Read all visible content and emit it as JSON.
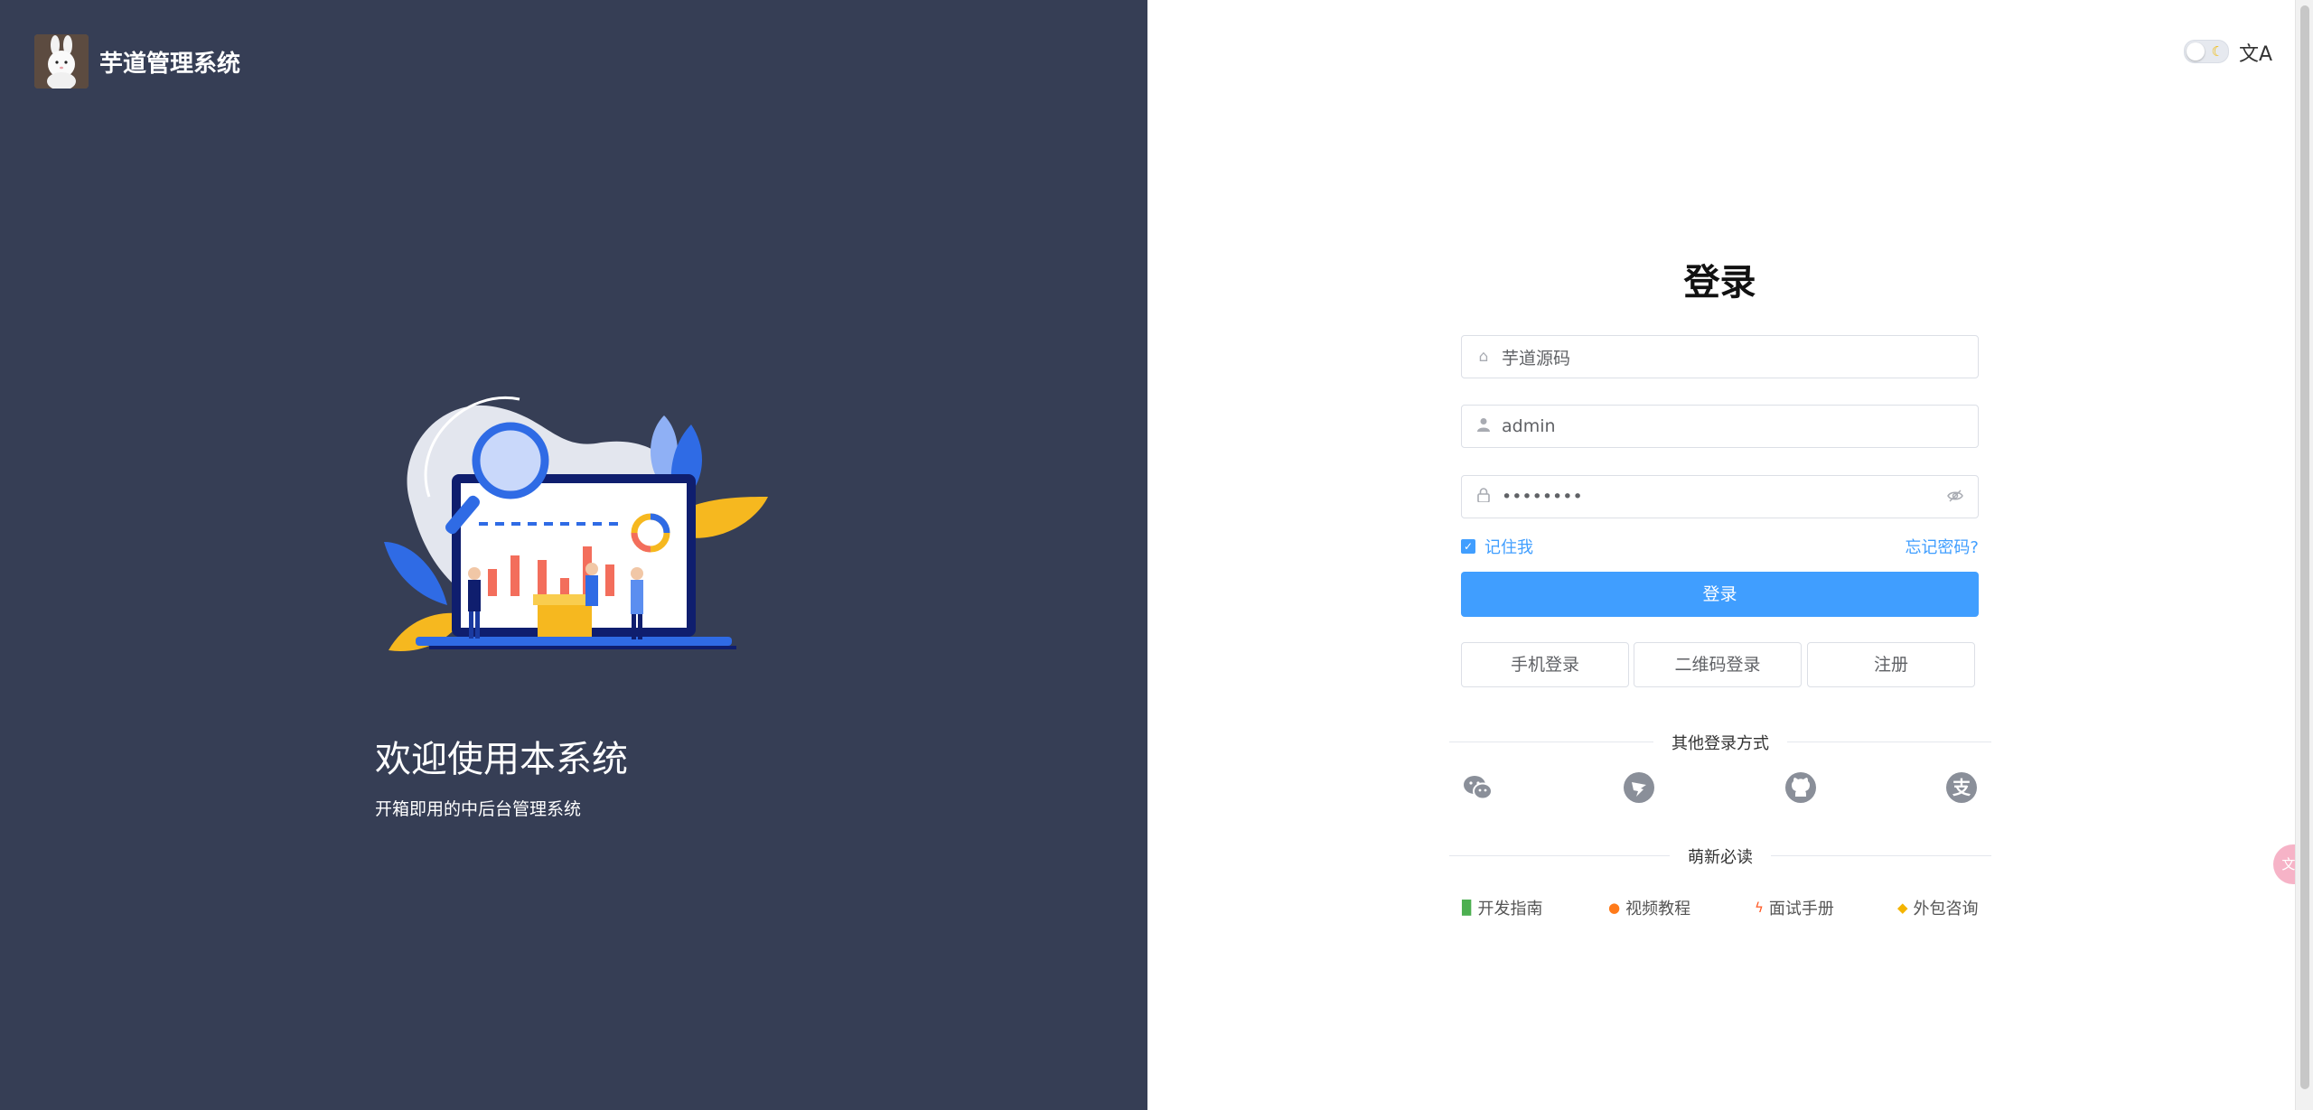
{
  "brand": {
    "title": "芋道管理系统"
  },
  "left": {
    "welcome": "欢迎使用本系统",
    "subtitle": "开箱即用的中后台管理系统"
  },
  "header": {
    "theme_icon": "moon-icon",
    "lang_icon": "translate-icon",
    "lang_glyph": "文A"
  },
  "login": {
    "title": "登录",
    "tenant_value": "芋道源码",
    "username_value": "admin",
    "password_value": "••••••••",
    "remember_label": "记住我",
    "forgot_label": "忘记密码?",
    "submit_label": "登录",
    "alt_buttons": [
      "手机登录",
      "二维码登录",
      "注册"
    ],
    "other_methods_label": "其他登录方式",
    "social_icons": [
      "wechat-icon",
      "dingtalk-icon",
      "github-icon",
      "alipay-icon"
    ],
    "newbie_label": "萌新必读",
    "links": [
      {
        "icon": "book-icon",
        "label": "开发指南"
      },
      {
        "icon": "fire-icon",
        "label": "视频教程"
      },
      {
        "icon": "lightning-icon",
        "label": "面试手册"
      },
      {
        "icon": "handshake-icon",
        "label": "外包咨询"
      }
    ]
  },
  "colors": {
    "left_bg": "#363e55",
    "accent": "#409eff"
  },
  "float_badge": "文A"
}
